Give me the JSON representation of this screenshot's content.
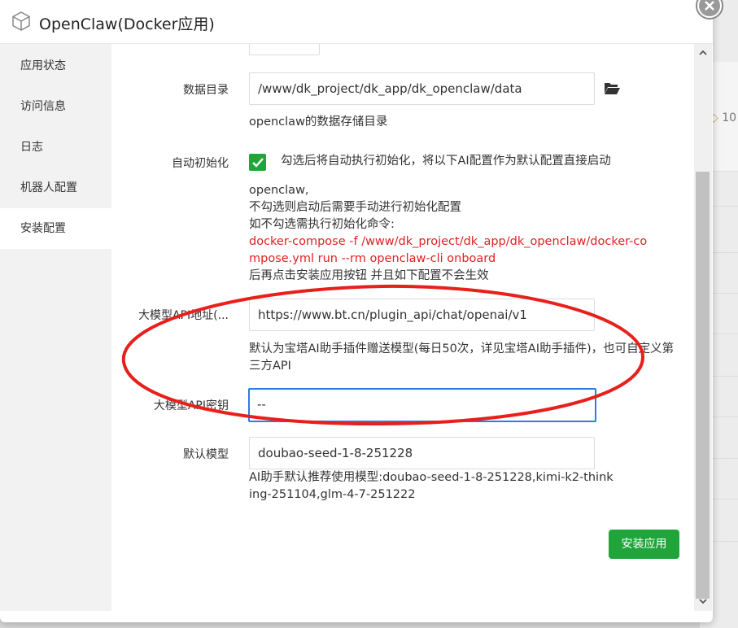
{
  "window": {
    "title": "OpenClaw(Docker应用)",
    "icon": "cube-icon"
  },
  "sidebar": {
    "items": [
      {
        "label": "应用状态"
      },
      {
        "label": "访问信息"
      },
      {
        "label": "日志"
      },
      {
        "label": "机器人配置"
      },
      {
        "label": "安装配置"
      }
    ],
    "active": "安装配置"
  },
  "form": {
    "data_dir": {
      "label": "数据目录",
      "value": "/www/dk_project/dk_app/dk_openclaw/data",
      "help": "openclaw的数据存储目录"
    },
    "auto_init": {
      "label": "自动初始化",
      "checked": true,
      "text": "勾选后将自动执行初始化，将以下AI配置作为默认配置直接启动",
      "help_line1": "openclaw,",
      "help_line2": "不勾选则启动后需要手动进行初始化配置",
      "help_line3": "如不勾选需执行初始化命令:",
      "command": "docker-compose -f /www/dk_project/dk_app/dk_openclaw/docker-compose.yml run --rm openclaw-cli onboard",
      "help_line4": "后再点击安装应用按钮 并且如下配置不会生效"
    },
    "api_url": {
      "label": "大模型API地址(...",
      "value": "https://www.bt.cn/plugin_api/chat/openai/v1",
      "help": "默认为宝塔AI助手插件赠送模型(每日50次，详见宝塔AI助手插件)，也可自定义第三方API"
    },
    "api_key": {
      "label": "大模型API密钥",
      "value": "--"
    },
    "default_model": {
      "label": "默认模型",
      "value": "doubao-seed-1-8-251228",
      "help": "AI助手默认推荐使用模型:doubao-seed-1-8-251228,kimi-k2-thinking-251104,glm-4-7-251222"
    },
    "install_button": "安装应用"
  },
  "background": {
    "partial_text": "10"
  },
  "colors": {
    "accent_green": "#20a53a",
    "command_red": "#e02020",
    "annotation_red": "#e8201c",
    "focus_blue": "#2d7be5"
  }
}
